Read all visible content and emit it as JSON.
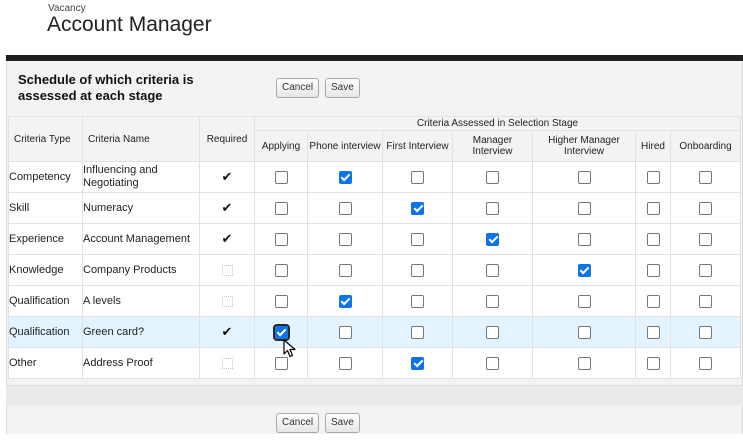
{
  "header": {
    "subtitle": "Vacancy",
    "title": "Account Manager"
  },
  "panel": {
    "heading_line1": "Schedule of which criteria is",
    "heading_line2": "assessed at each stage",
    "cancel_label": "Cancel",
    "save_label": "Save"
  },
  "table": {
    "stage_group_label": "Criteria Assessed in Selection Stage",
    "columns": {
      "criteria_type": "Criteria Type",
      "criteria_name": "Criteria Name",
      "required": "Required",
      "stages": [
        "Applying",
        "Phone interview",
        "First Interview",
        "Manager Interview",
        "Higher Manager Interview",
        "Hired",
        "Onboarding"
      ]
    },
    "rows": [
      {
        "type": "Competency",
        "name": "Influencing and Negotiating",
        "required": true,
        "stages": [
          false,
          true,
          false,
          false,
          false,
          false,
          false
        ]
      },
      {
        "type": "Skill",
        "name": "Numeracy",
        "required": true,
        "stages": [
          false,
          false,
          true,
          false,
          false,
          false,
          false
        ]
      },
      {
        "type": "Experience",
        "name": "Account Management",
        "required": true,
        "stages": [
          false,
          false,
          false,
          true,
          false,
          false,
          false
        ]
      },
      {
        "type": "Knowledge",
        "name": "Company Products",
        "required": false,
        "stages": [
          false,
          false,
          false,
          false,
          true,
          false,
          false
        ]
      },
      {
        "type": "Qualification",
        "name": "A levels",
        "required": false,
        "stages": [
          false,
          true,
          false,
          false,
          false,
          false,
          false
        ]
      },
      {
        "type": "Qualification",
        "name": "Green card?",
        "required": true,
        "stages": [
          true,
          false,
          false,
          false,
          false,
          false,
          false
        ],
        "highlighted": true
      },
      {
        "type": "Other",
        "name": "Address Proof",
        "required": false,
        "stages": [
          false,
          false,
          true,
          false,
          false,
          false,
          false
        ]
      }
    ]
  },
  "icons": {
    "required_check": "checkmark-icon",
    "cursor": "pointer-cursor-icon"
  },
  "colors": {
    "checkbox_on": "#0b74e8",
    "row_highlight": "#e3f3ff",
    "top_bar": "#1f1f1f"
  }
}
